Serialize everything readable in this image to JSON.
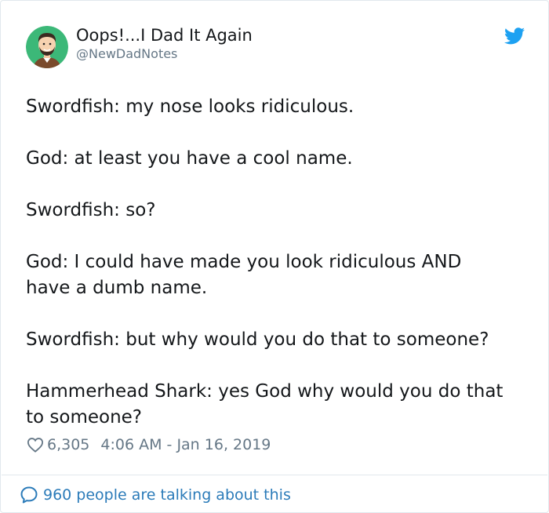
{
  "author": {
    "name": "Oops!...I Dad It Again",
    "handle": "@NewDadNotes"
  },
  "tweet": {
    "lines": [
      [
        "Swordfish: my nose looks ridiculous."
      ],
      [
        "God: at least you have a cool name."
      ],
      [
        "Swordfish: so?"
      ],
      [
        "God: I could have made you look ridiculous AND",
        "have a dumb name."
      ],
      [
        "Swordfish: but why would you do that to someone?"
      ],
      [
        "Hammerhead Shark: yes God why would you do that",
        "to someone?"
      ]
    ]
  },
  "meta": {
    "likes": "6,305",
    "timestamp": "4:06 AM - Jan 16, 2019"
  },
  "footer": {
    "conversation_label": "960 people are talking about this"
  },
  "colors": {
    "twitter_blue": "#1da1f2",
    "link_blue": "#2b7bb9",
    "text": "#14171a",
    "secondary": "#657786",
    "avatar_bg": "#3cb878"
  },
  "icons": {
    "brand": "twitter-bird-icon",
    "like": "heart-icon",
    "conversation": "speech-bubble-icon"
  }
}
